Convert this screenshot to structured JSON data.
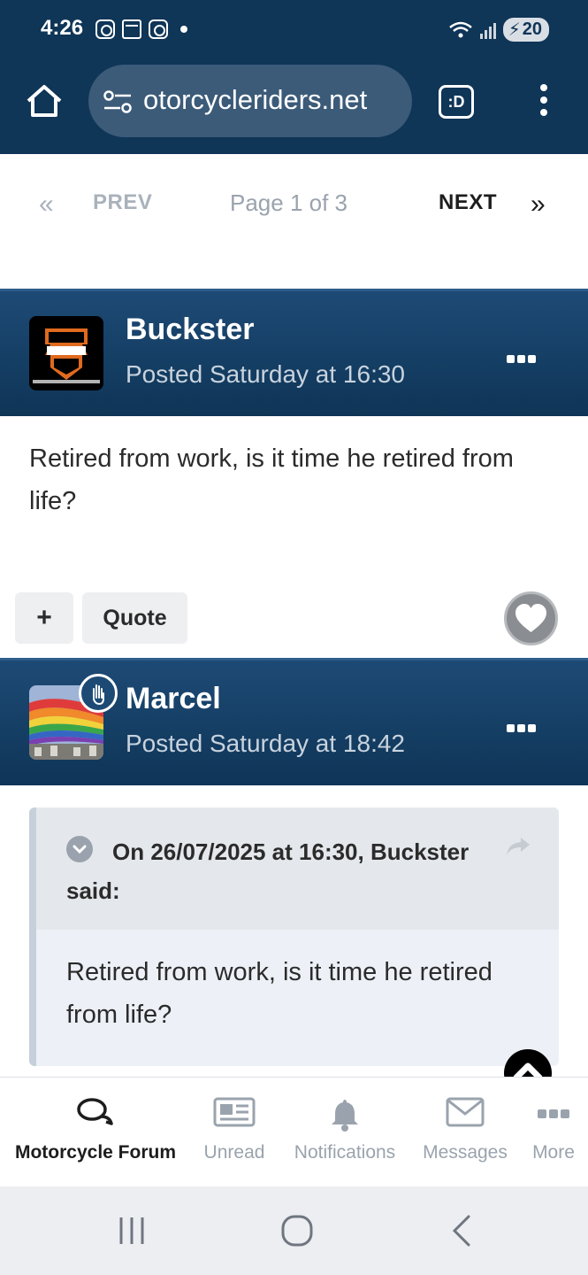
{
  "status_bar": {
    "time": "4:26",
    "battery": "20"
  },
  "browser": {
    "url": "otorcycleriders.net",
    "tabs_label": ":D"
  },
  "pagination": {
    "prev_arrow": "«",
    "prev": "PREV",
    "page": "Page 1 of 3",
    "next": "NEXT",
    "next_arrow": "»"
  },
  "posts": [
    {
      "author": "Buckster",
      "posted": "Posted Saturday at 16:30",
      "body": "Retired from work, is it time he retired from life?",
      "actions": {
        "plus": "+",
        "quote": "Quote"
      }
    },
    {
      "author": "Marcel",
      "posted": "Posted Saturday at 18:42",
      "quote": {
        "cite": "On 26/07/2025 at 16:30, Buckster said:",
        "text": "Retired from work, is it time he retired from life?"
      }
    }
  ],
  "bottom_nav": [
    {
      "label": "Motorcycle Forum",
      "icon": "chat-bubbles-icon",
      "active": true
    },
    {
      "label": "Unread",
      "icon": "newspaper-icon"
    },
    {
      "label": "Notifications",
      "icon": "bell-icon"
    },
    {
      "label": "Messages",
      "icon": "envelope-icon"
    },
    {
      "label": "More",
      "icon": "more-dots-icon"
    }
  ],
  "colors": {
    "header_bg": "#0f3557",
    "accent": "#1d4a75",
    "muted": "#9aa3ad"
  }
}
